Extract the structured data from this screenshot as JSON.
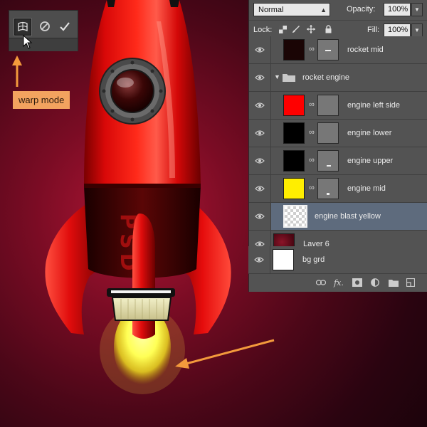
{
  "warp_toolbar": {
    "buttons": [
      {
        "icon": "warp-mesh-icon",
        "state": "active"
      },
      {
        "icon": "cancel-icon"
      },
      {
        "icon": "commit-check-icon"
      }
    ]
  },
  "callout": {
    "text": "warp mode",
    "color": "#f3a35f"
  },
  "rocket": {
    "badge_text": "PSD",
    "body_color": "#e01010",
    "flame_color": "#ffff66"
  },
  "panel": {
    "blend_mode": "Normal",
    "opacity_label": "Opacity:",
    "opacity_value": "100%",
    "lock_label": "Lock:",
    "fill_label": "Fill:",
    "fill_value": "100%",
    "layers": [
      {
        "name": "rocket mid",
        "thumb_color": "#1a0505",
        "mask": true,
        "kind": "layer"
      },
      {
        "name": "rocket engine",
        "kind": "group",
        "expanded": true
      },
      {
        "name": "engine left side",
        "thumb_color": "#ff0000",
        "mask": true,
        "kind": "layer"
      },
      {
        "name": "engine lower",
        "thumb_color": "#000000",
        "mask": true,
        "kind": "layer"
      },
      {
        "name": "engine upper",
        "thumb_color": "#000000",
        "mask": true,
        "kind": "layer"
      },
      {
        "name": "engine mid",
        "thumb_color": "#ffee00",
        "mask": true,
        "kind": "layer"
      },
      {
        "name": "engine blast yellow",
        "thumb": "transparent",
        "mask": false,
        "selected": true,
        "kind": "layer"
      },
      {
        "name": "Layer 6",
        "thumb_color": "#5a0a18",
        "mask": false,
        "kind": "layer"
      },
      {
        "name": "bg grd",
        "thumb_color": "#ffffff",
        "mask": false,
        "kind": "layer"
      }
    ],
    "footer_icons": [
      "link-layers-icon",
      "fx-icon",
      "add-mask-icon",
      "adjustment-layer-icon",
      "new-group-icon",
      "new-layer-icon"
    ],
    "footer_fx_text": "fx."
  },
  "colors": {
    "accent_arrow": "#f39a3c",
    "panel_bg": "#535353",
    "selected_row": "#5e6b7d"
  }
}
